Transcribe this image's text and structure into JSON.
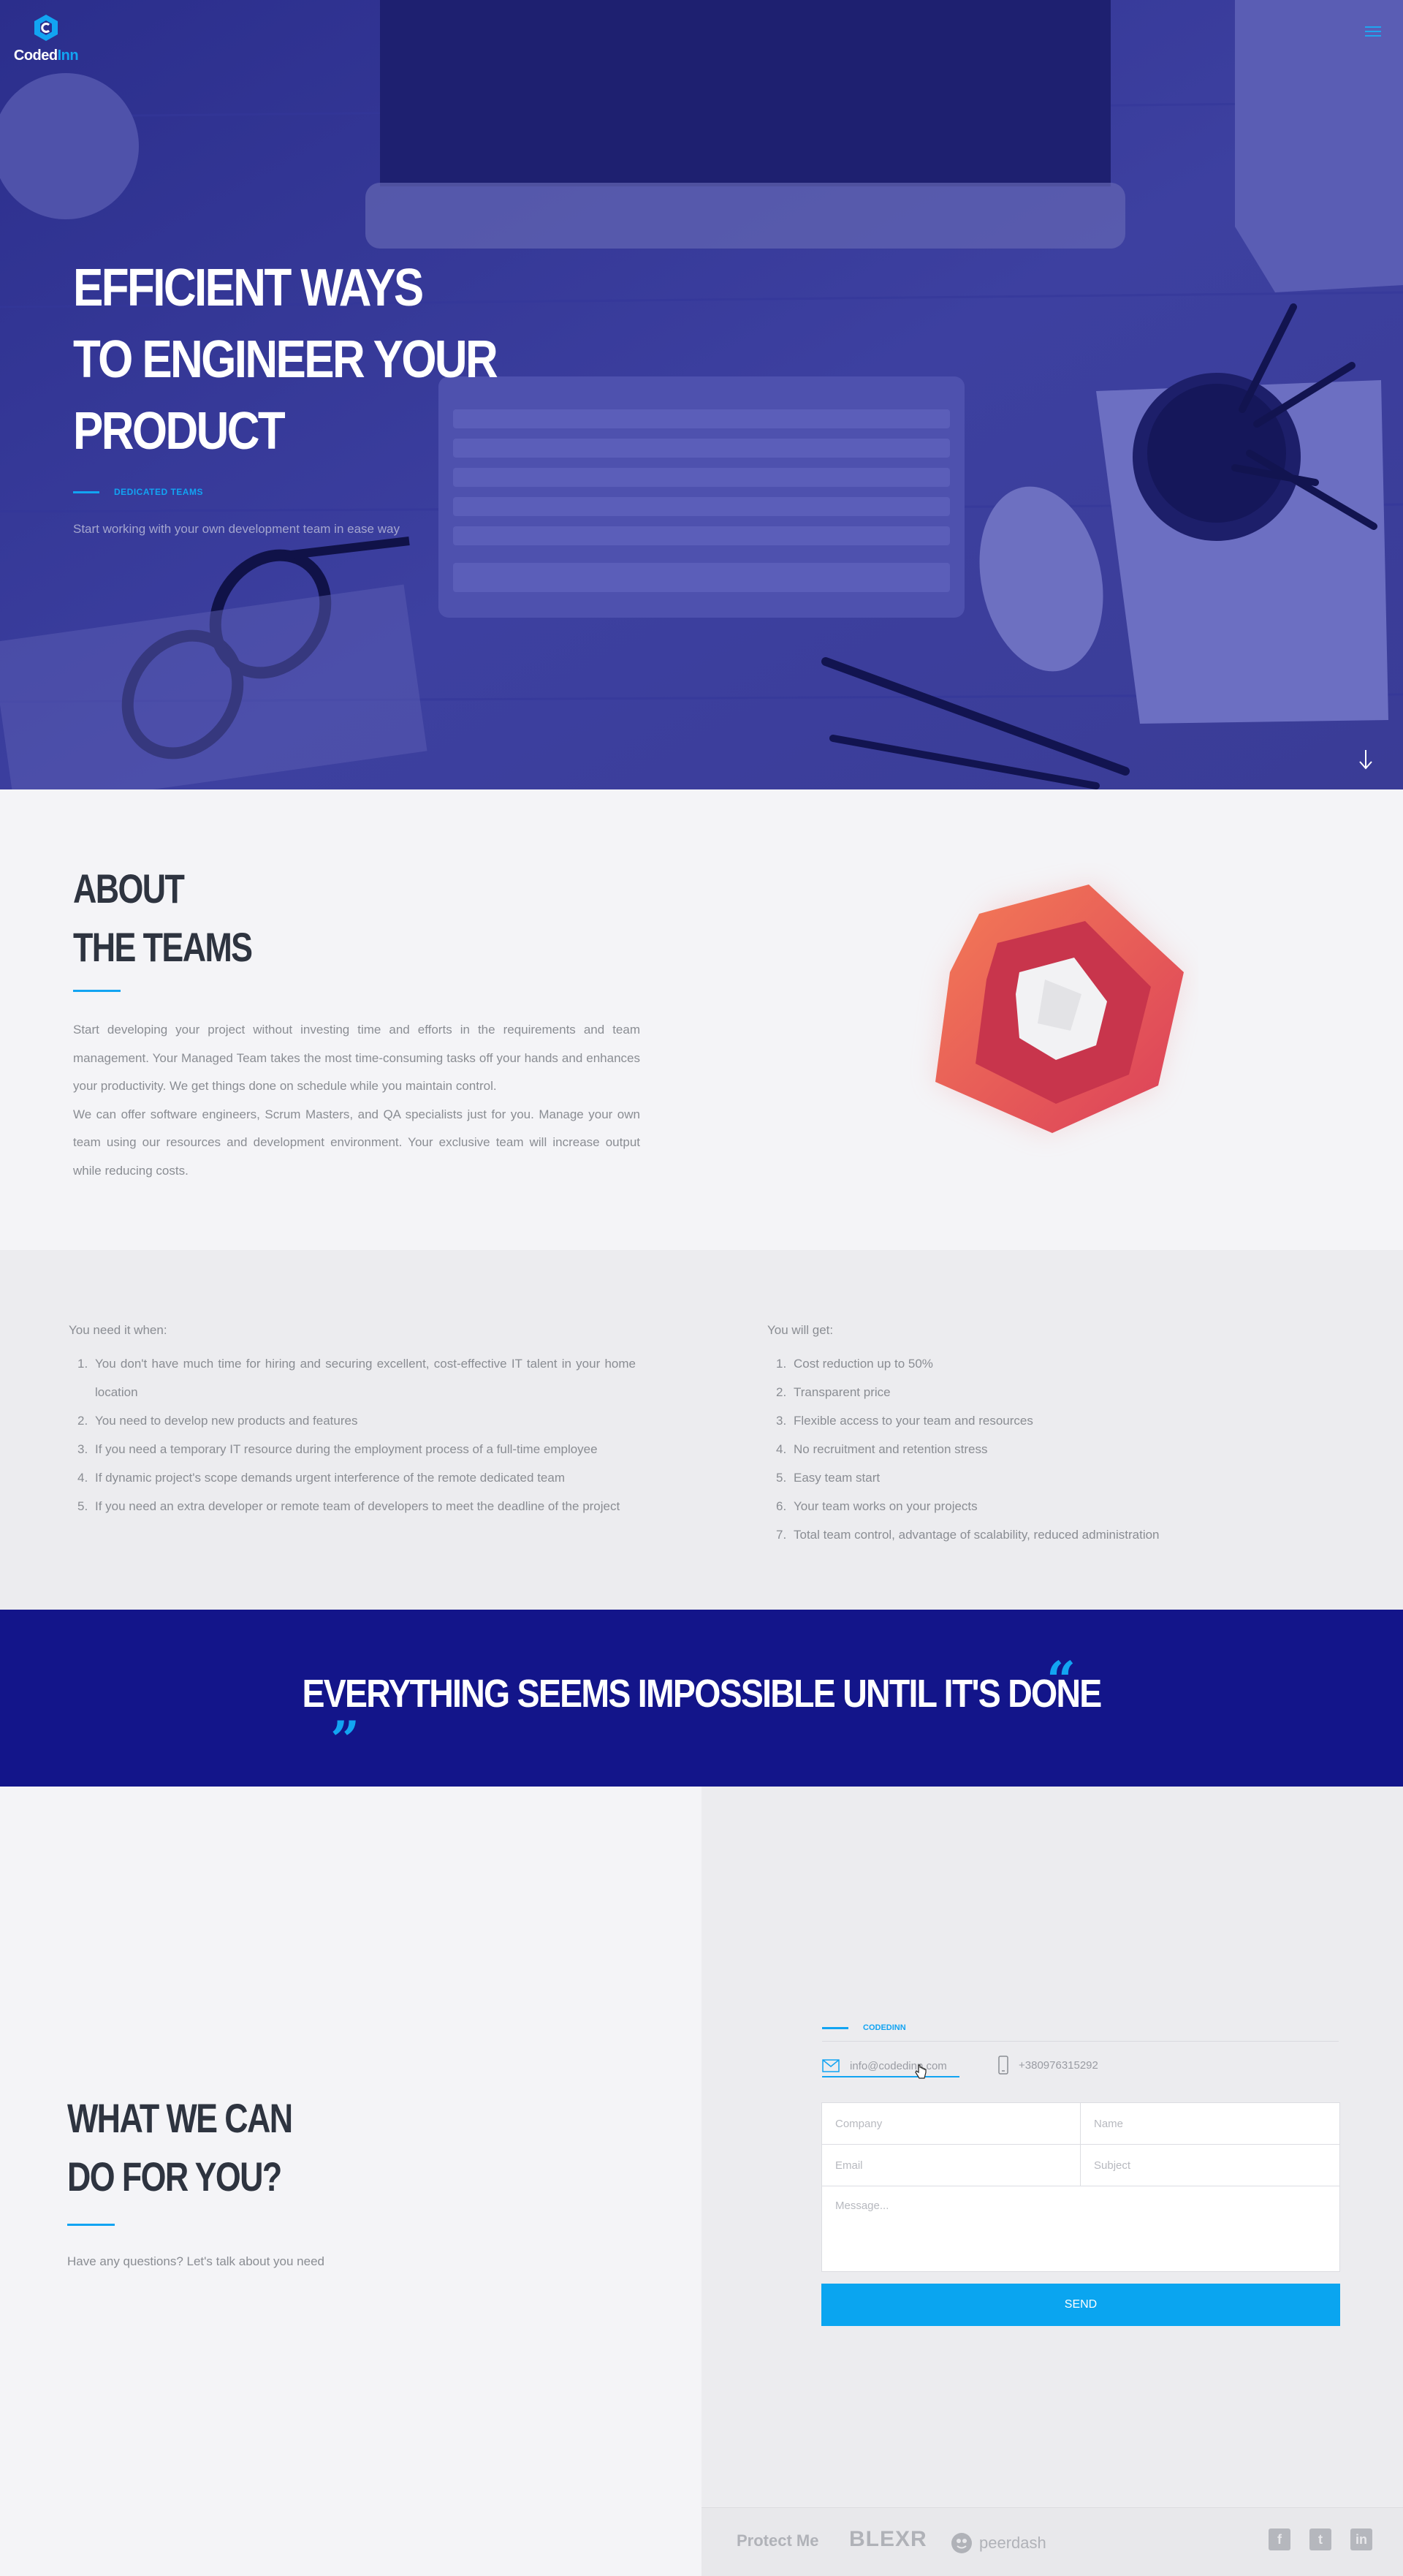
{
  "brand": {
    "name_part1": "Coded",
    "name_part2": "Inn"
  },
  "hero": {
    "title_line1": "EFFICIENT WAYS",
    "title_line2": "TO ENGINEER YOUR",
    "title_line3": "PRODUCT",
    "tag": "DEDICATED TEAMS",
    "subtitle": "Start working with your own development team in ease way"
  },
  "about": {
    "title_line1": "ABOUT",
    "title_line2": "THE TEAMS",
    "paragraph1": "Start developing your project without investing time and efforts in the requirements and team management. Your Managed Team takes the most time-consuming tasks off your hands and enhances your productivity. We get things done on schedule while you maintain control.",
    "paragraph2": "We can offer software engineers, Scrum Masters, and QA specialists just for you. Manage your own team using our resources and development environment. Your exclusive team will increase output while reducing costs."
  },
  "needs": {
    "heading": "You need it when:",
    "items": [
      "You don't have much time for hiring and securing excellent, cost-effective IT talent in your home location",
      "You need to develop new products and features",
      "If you need a temporary IT resource during the employment process of a full-time employee",
      "If dynamic project's scope demands urgent interference of the remote dedicated team",
      "If you need an extra developer or remote team of developers to meet the deadline of the project"
    ]
  },
  "gets": {
    "heading": "You will get:",
    "items": [
      "Cost reduction up to 50%",
      "Transparent price",
      "Flexible access to your team and resources",
      "No recruitment and retention stress",
      "Easy team start",
      "Your team works on your projects",
      "Total team control, advantage of scalability, reduced administration"
    ]
  },
  "quote": {
    "text": "EVERYTHING SEEMS IMPOSSIBLE UNTIL IT'S DONE",
    "open_mark": "“",
    "close_mark": "”"
  },
  "contact": {
    "title_line1": "WHAT WE CAN",
    "title_line2": "DO FOR YOU?",
    "subtitle": "Have any questions? Let's talk about you need",
    "tag": "CODEDINN",
    "email": "info@codedinn.com",
    "phone": "+380976315292",
    "placeholders": {
      "company": "Company",
      "name": "Name",
      "email": "Email",
      "subject": "Subject",
      "message": "Message..."
    },
    "send_label": "SEND"
  },
  "footer": {
    "partners": [
      "Protect Me",
      "BLEXR",
      "peerdash"
    ],
    "social": [
      {
        "icon": "facebook-icon",
        "glyph": "f"
      },
      {
        "icon": "twitter-icon",
        "glyph": "t"
      },
      {
        "icon": "linkedin-icon",
        "glyph": "in"
      }
    ]
  },
  "colors": {
    "accent": "#12a4f2",
    "hero_overlay": "#2c2f8e",
    "quote_bg": "#13158a",
    "hex_red": "#e0474f",
    "heading": "#2e3440"
  }
}
